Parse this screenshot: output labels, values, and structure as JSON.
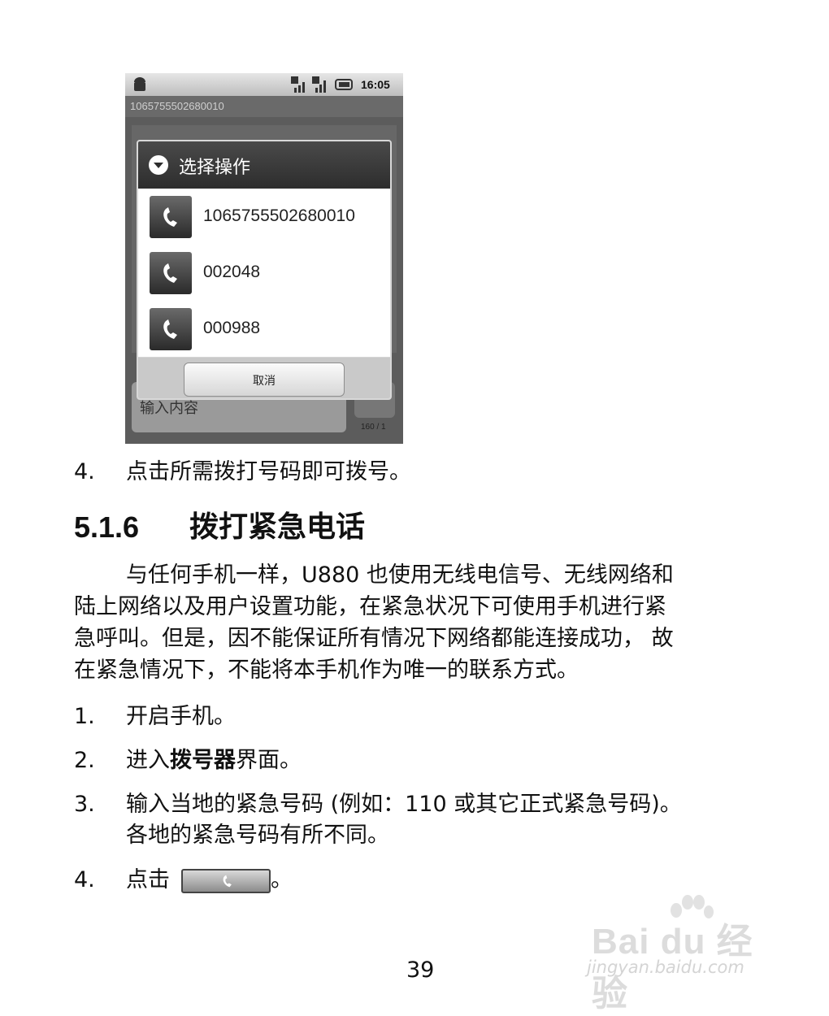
{
  "phone": {
    "clock": "16:05",
    "titlebar": "1065755502680010",
    "bg_input_placeholder": "输入内容",
    "bg_counter": "160 / 1",
    "dialog": {
      "title": "选择操作",
      "options": [
        "1065755502680010",
        "002048",
        "000988"
      ],
      "cancel_label": "取消"
    }
  },
  "step_4a": {
    "num": "4.",
    "text": "点击所需拨打号码即可拨号。"
  },
  "heading": {
    "number": "5.1.6",
    "title": "拨打紧急电话"
  },
  "paragraph": {
    "lines": [
      "与任何手机一样，U880 也使用无线电信号、无线网络和",
      "陆上网络以及用户设置功能，在紧急状况下可使用手机进行紧",
      "急呼叫。但是，因不能保证所有情况下网络都能连接成功， 故",
      "在紧急情况下，不能将本手机作为唯一的联系方式。"
    ]
  },
  "steps": {
    "s1": {
      "num": "1.",
      "text": "开启手机。"
    },
    "s2": {
      "num": "2.",
      "before": "进入",
      "bold": "拨号器",
      "after": "界面。"
    },
    "s3": {
      "num": "3.",
      "line1": "输入当地的紧急号码 (例如：110 或其它正式紧急号码)。",
      "line2": "各地的紧急号码有所不同。"
    },
    "s4": {
      "num": "4.",
      "before": "点击",
      "after": "。"
    }
  },
  "page_number": "39",
  "watermark": {
    "logo": "Bai du 经验",
    "url": "jingyan.baidu.com"
  }
}
